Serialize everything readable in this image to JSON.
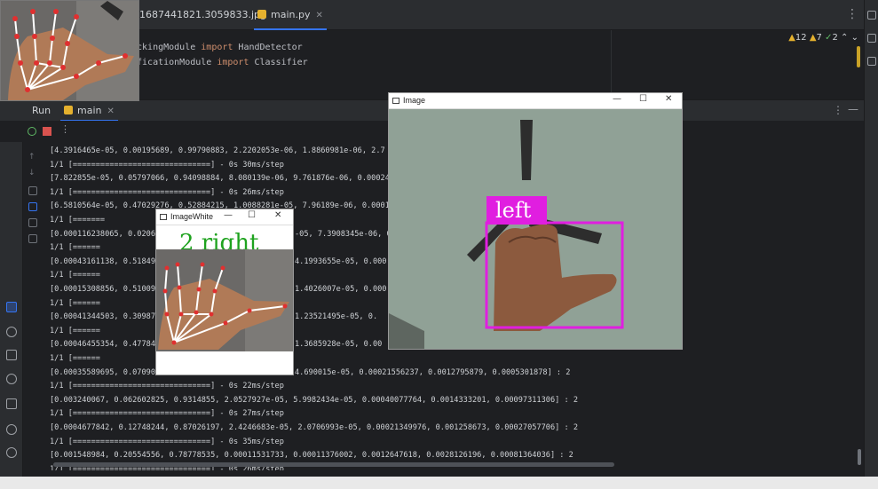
{
  "editor": {
    "tabs": [
      {
        "label": "1687441821.3059833.jpg",
        "active": false
      },
      {
        "label": "main.py",
        "active": true
      }
    ],
    "code": [
      {
        "pre": "ackingModule ",
        "kw": "import",
        "post": " HandDetector"
      },
      {
        "pre": "ificationModule ",
        "kw": "import",
        "post": " Classifier"
      }
    ],
    "inspections": {
      "warnings_a": "12",
      "warnings_b": "7",
      "ok": "2"
    }
  },
  "run": {
    "label": "Run",
    "tab": "main"
  },
  "console_lines": [
    "[4.3916465e-05, 0.00195689, 0.99790883, 2.2202053e-06, 1.8860981e-06, 2.7",
    "1/1 [==============================] - 0s 30ms/step",
    "[7.822855e-05, 0.05797066, 0.94098884, 8.080139e-06, 9.761876e-06, 0.00024",
    "1/1 [==============================] - 0s 26ms/step",
    "[6.5810564e-05, 0.47029276, 0.52884215, 1.0088281e-05, 7.96189e-06, 0.0001",
    "1/1 [=======",
    "[0.000116238065, 0.0206",
    "1/1 [======",
    "[0.00043161138, 0.51849",
    "1/1 [======",
    "[0.00015308856, 0.51009",
    "1/1 [======",
    "[0.00041344503, 0.30987",
    "1/1 [======",
    "[0.00046455354, 0.47784",
    "1/1 [======",
    "[0.00035589695, 0.07090",
    "1/1 [==============================] - 0s 22ms/step",
    "[0.003240067, 0.062602825, 0.9314855, 2.0527927e-05, 5.9982434e-05, 0.00040077764, 0.0014333201, 0.00097311306] : 2",
    "1/1 [==============================] - 0s 27ms/step",
    "[0.0004677842, 0.12748244, 0.87026197, 2.4246683e-05, 2.0706993e-05, 0.00021349976, 0.001258673, 0.00027057706] : 2",
    "1/1 [==============================] - 0s 35ms/step",
    "[0.001548984, 0.20554556, 0.78778535, 0.00011531733, 0.00011376002, 0.0012647618, 0.0028126196, 0.00081364036] : 2",
    "1/1 [==============================] - 0s 26ms/step"
  ],
  "console_tails": [
    {
      "row": 6,
      "text": "-05, 7.3908345e-06, 0."
    },
    {
      "row": 8,
      "text": "4.1993655e-05, 0.000"
    },
    {
      "row": 10,
      "text": "1.4026007e-05, 0.000"
    },
    {
      "row": 12,
      "text": "1.23521495e-05, 0."
    },
    {
      "row": 14,
      "text": "1.3685928e-05, 0.00"
    },
    {
      "row": 16,
      "text": "4.690015e-05, 0.00021556237, 0.0012795879, 0.0005301878] : 2"
    }
  ],
  "windows": {
    "image": {
      "title": "Image",
      "label": "left"
    },
    "image_white": {
      "title": "ImageWhite",
      "label": "2 right"
    }
  },
  "colors": {
    "accent": "#3574f0",
    "magenta": "#e01ee0",
    "hand_line": "#ffffff",
    "hand_point": "#e03030",
    "green_text": "#1fa31f"
  }
}
